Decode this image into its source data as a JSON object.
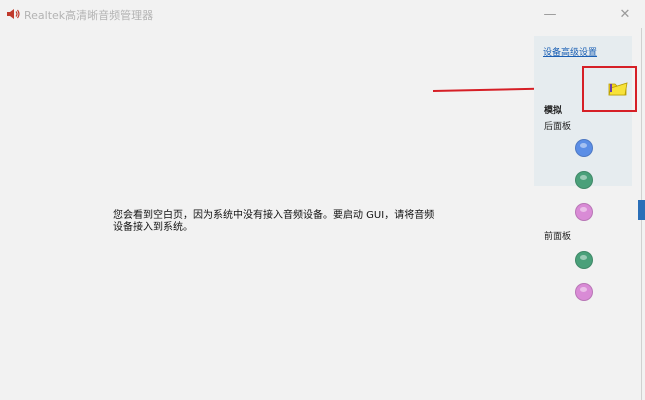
{
  "window": {
    "title": "Realtek高清晰音频管理器",
    "minimize_glyph": "—",
    "close_glyph": "✕"
  },
  "main": {
    "message": "您会看到空白页，因为系统中没有接入音频设备。要启动 GUI，请将音频设备接入到系统。"
  },
  "panel": {
    "advanced_link": "设备高级设置",
    "analog_label": "模拟",
    "back_panel_label": "后面板",
    "front_panel_label": "前面板",
    "folder_icon": "folder-icon",
    "jacks_back": [
      {
        "name": "blue",
        "color": "#5b8ee6"
      },
      {
        "name": "green",
        "color": "#4aa07a"
      },
      {
        "name": "pink",
        "color": "#d98bd6"
      }
    ],
    "jacks_front": [
      {
        "name": "green",
        "color": "#4aa07a"
      },
      {
        "name": "pink",
        "color": "#d98bd6"
      }
    ]
  },
  "colors": {
    "annotation_red": "#d61f26",
    "link_blue": "#1a5fb4"
  }
}
